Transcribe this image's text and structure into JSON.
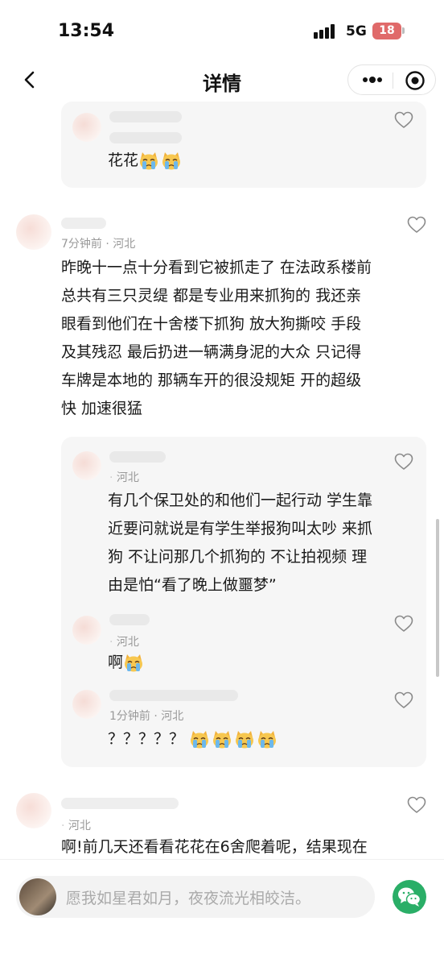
{
  "status_bar": {
    "time": "13:54",
    "network": "5G",
    "battery": "18"
  },
  "nav": {
    "title": "详情"
  },
  "comments": [
    {
      "replies": [
        {
          "text": "花花"
        }
      ]
    },
    {
      "time": "7分钟前",
      "location": "河北",
      "text_lines": [
        "昨晚十一点十分看到它被抓走了 在法政系楼前",
        "总共有三只灵缇 都是专业用来抓狗的 我还亲",
        "眼看到他们在十舍楼下抓狗 放大狗撕咬 手段",
        "及其残忍 最后扔进一辆满身泥的大众 只记得",
        "车牌是本地的 那辆车开的很没规矩 开的超级",
        "快 加速很猛"
      ],
      "replies": [
        {
          "location": "河北",
          "text_lines": [
            "有几个保卫处的和他们一起行动 学生靠",
            "近要问就说是有学生举报狗叫太吵 来抓",
            "狗 不让问那几个抓狗的 不让拍视频 理",
            "由是怕“看了晚上做噩梦”"
          ]
        },
        {
          "location": "河北",
          "text": "啊"
        },
        {
          "time": "1分钟前",
          "location": "河北",
          "text": "？？？？？"
        }
      ]
    },
    {
      "location": "河北",
      "text": "啊!前几天还看看花花在6舍爬着呢，结果现在"
    }
  ],
  "input": {
    "placeholder": "愿我如星君如月，夜夜流光相皎洁。"
  },
  "icons": {
    "back": "chevron-left-icon",
    "more": "more-dots-icon",
    "close": "mini-program-close-icon",
    "like": "heart-outline-icon",
    "emoji": "crying-cat-emoji-icon",
    "share": "wechat-icon"
  },
  "colors": {
    "wechat_green": "#2aae67",
    "battery": "#e06a6a",
    "reply_bg": "#f6f6f6",
    "meta_text": "#999999"
  }
}
